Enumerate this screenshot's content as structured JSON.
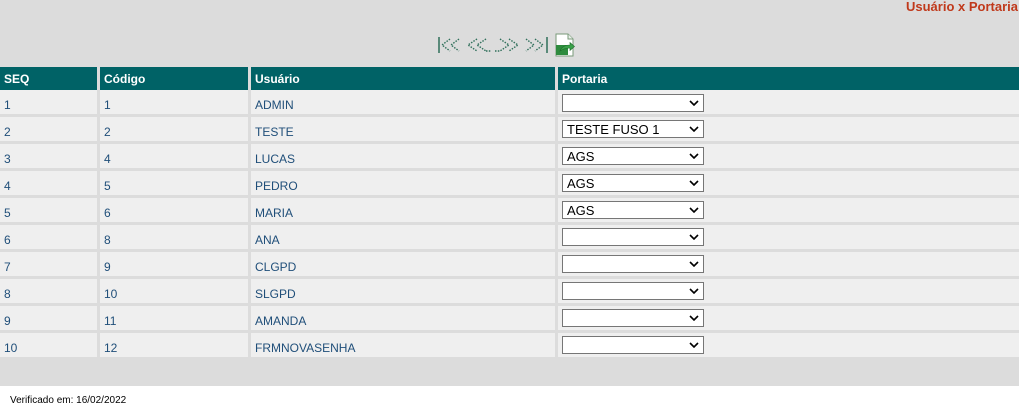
{
  "header": {
    "title": "Usuário x Portaria"
  },
  "pager": {
    "icons": [
      "first-page-icon",
      "previous-page-icon",
      "next-page-icon",
      "last-page-icon",
      "export-excel-icon"
    ]
  },
  "table": {
    "columns": [
      "SEQ",
      "Código",
      "Usuário",
      "Portaria"
    ],
    "rows": [
      {
        "seq": "1",
        "codigo": "1",
        "usuario": "ADMIN",
        "portaria": ""
      },
      {
        "seq": "2",
        "codigo": "2",
        "usuario": "TESTE",
        "portaria": "TESTE FUSO 1"
      },
      {
        "seq": "3",
        "codigo": "4",
        "usuario": "LUCAS",
        "portaria": "AGS"
      },
      {
        "seq": "4",
        "codigo": "5",
        "usuario": "PEDRO",
        "portaria": "AGS"
      },
      {
        "seq": "5",
        "codigo": "6",
        "usuario": "MARIA",
        "portaria": "AGS"
      },
      {
        "seq": "6",
        "codigo": "8",
        "usuario": "ANA",
        "portaria": ""
      },
      {
        "seq": "7",
        "codigo": "9",
        "usuario": "CLGPD",
        "portaria": ""
      },
      {
        "seq": "8",
        "codigo": "10",
        "usuario": "SLGPD",
        "portaria": ""
      },
      {
        "seq": "9",
        "codigo": "11",
        "usuario": "AMANDA",
        "portaria": ""
      },
      {
        "seq": "10",
        "codigo": "12",
        "usuario": "FRMNOVASENHA",
        "portaria": ""
      }
    ]
  },
  "footer": {
    "verified": "Verificado em: 16/02/2022"
  },
  "colors": {
    "header_bg": "#006266",
    "title": "#c0391b",
    "cell_text": "#1f4e79"
  }
}
